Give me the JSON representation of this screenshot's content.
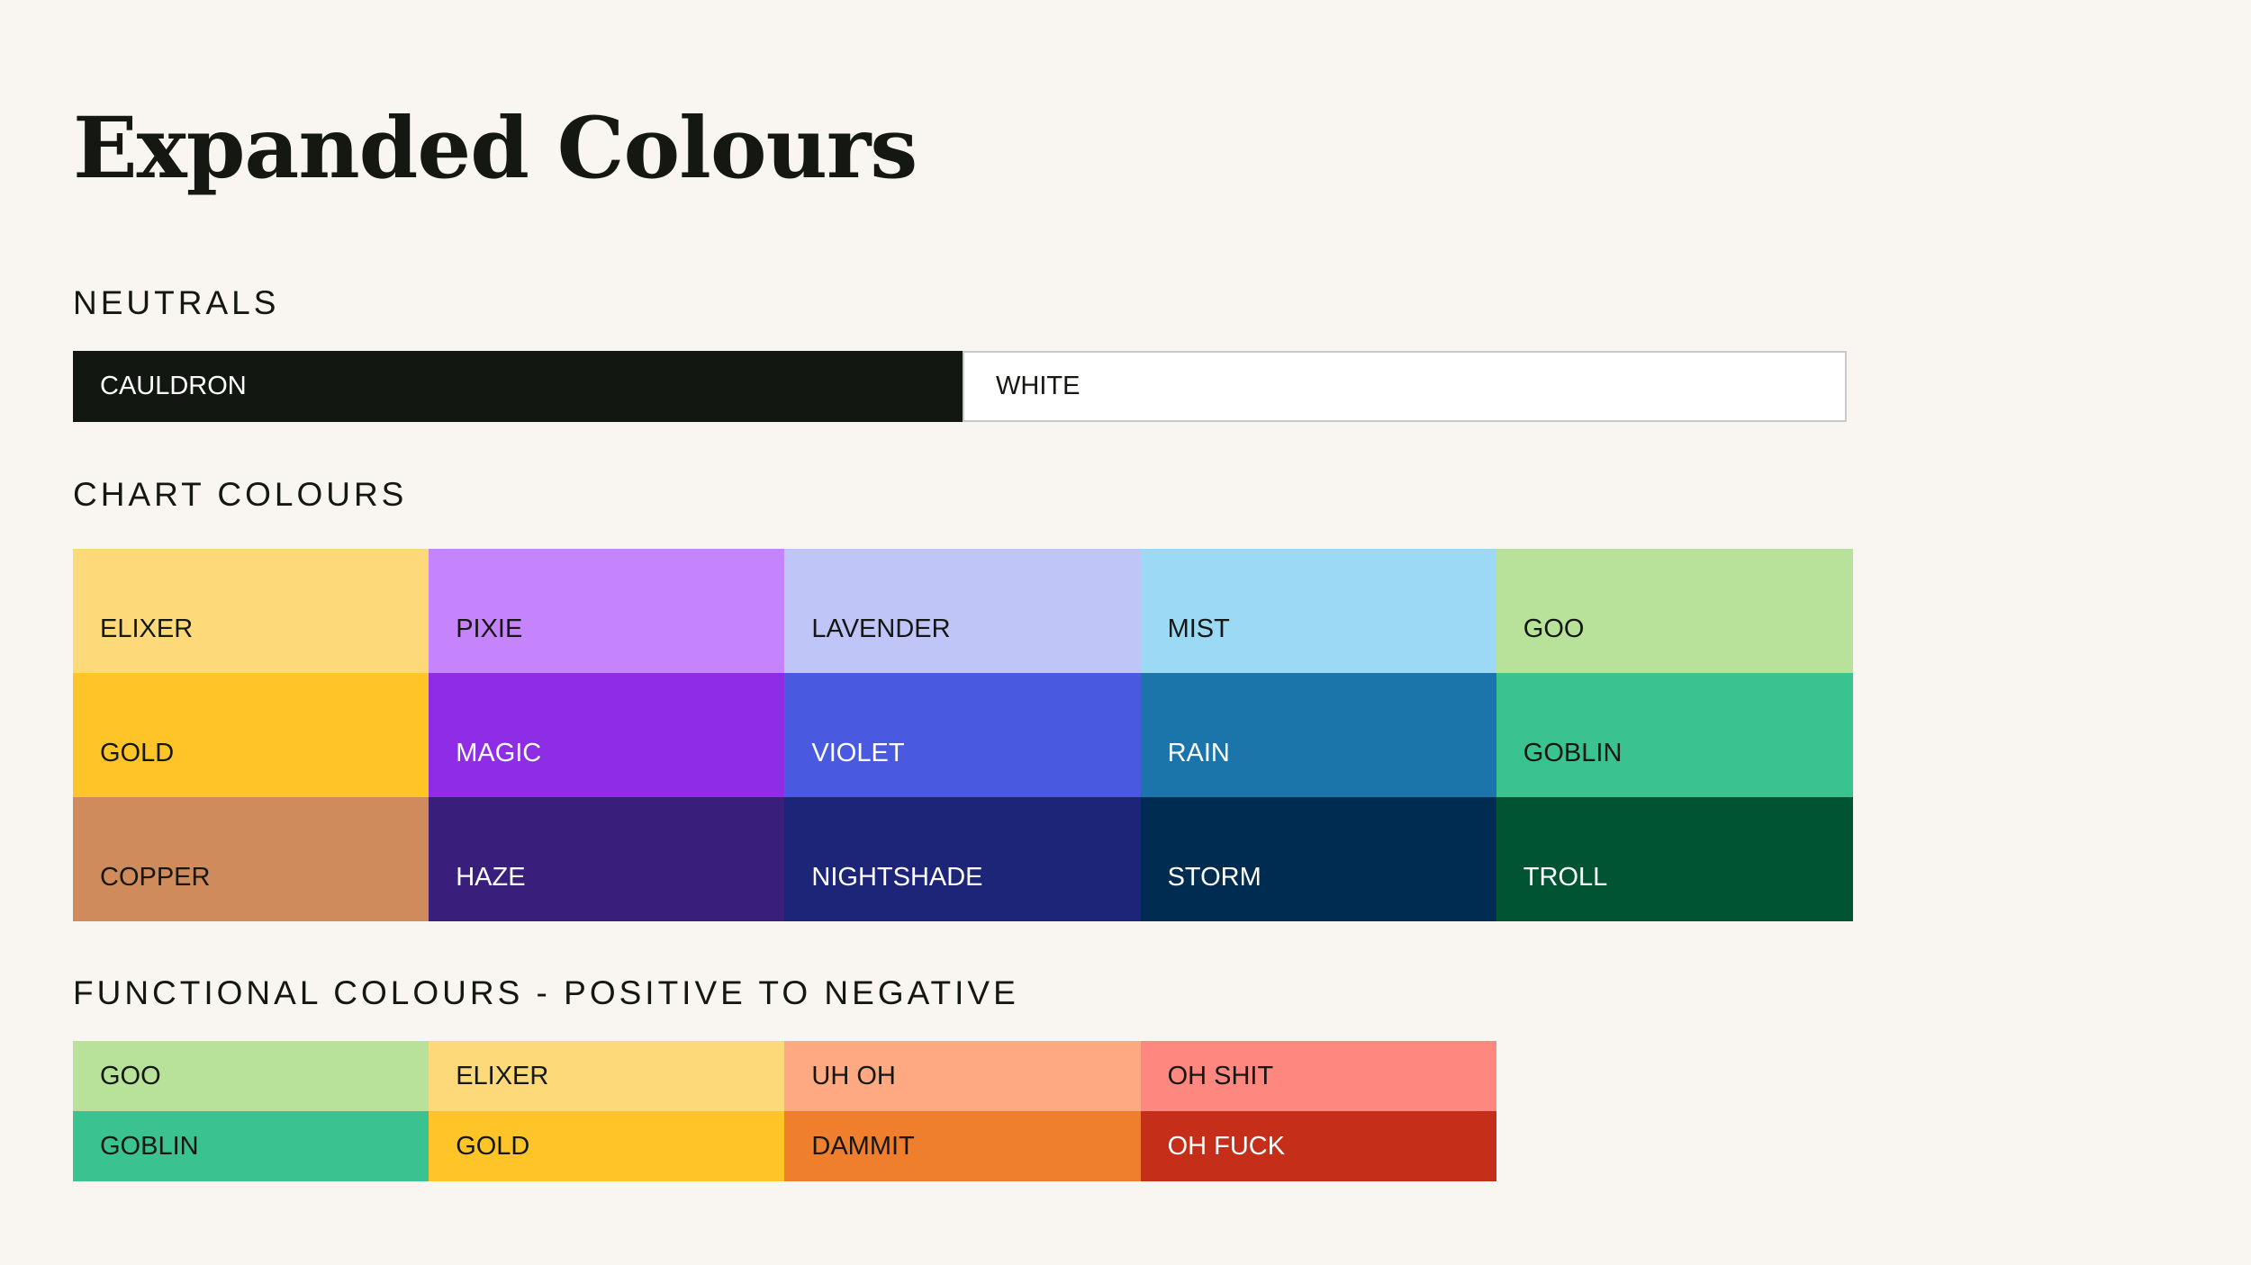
{
  "title": "Expanded Colours",
  "sections": {
    "neutrals": {
      "heading": "NEUTRALS",
      "swatches": [
        {
          "label": "CAULDRON",
          "color": "#131712",
          "text_color": "#ffffff"
        },
        {
          "label": "WHITE",
          "color": "#ffffff",
          "text_color": "#141712"
        }
      ]
    },
    "chart": {
      "heading": "CHART COLOURS",
      "rows": [
        [
          {
            "label": "ELIXER",
            "color": "#fed97a",
            "text_color": "#141712"
          },
          {
            "label": "PIXIE",
            "color": "#c684fc",
            "text_color": "#141712"
          },
          {
            "label": "LAVENDER",
            "color": "#c0c5f8",
            "text_color": "#141712"
          },
          {
            "label": "MIST",
            "color": "#9bd9f4",
            "text_color": "#141712"
          },
          {
            "label": "GOO",
            "color": "#b8e199",
            "text_color": "#141712"
          }
        ],
        [
          {
            "label": "GOLD",
            "color": "#fec428",
            "text_color": "#141712"
          },
          {
            "label": "MAGIC",
            "color": "#8e2ce6",
            "text_color": "#ffffff"
          },
          {
            "label": "VIOLET",
            "color": "#4a5ae0",
            "text_color": "#ffffff"
          },
          {
            "label": "RAIN",
            "color": "#1b74aa",
            "text_color": "#ffffff"
          },
          {
            "label": "GOBLIN",
            "color": "#3ac391",
            "text_color": "#141712"
          }
        ],
        [
          {
            "label": "COPPER",
            "color": "#cf8b5b",
            "text_color": "#141712"
          },
          {
            "label": "HAZE",
            "color": "#391f7b",
            "text_color": "#ffffff"
          },
          {
            "label": "NIGHTSHADE",
            "color": "#1d2579",
            "text_color": "#ffffff"
          },
          {
            "label": "STORM",
            "color": "#002c51",
            "text_color": "#ffffff"
          },
          {
            "label": "TROLL",
            "color": "#005433",
            "text_color": "#ffffff"
          }
        ]
      ]
    },
    "functional": {
      "heading": "FUNCTIONAL COLOURS - POSITIVE TO NEGATIVE",
      "rows": [
        [
          {
            "label": "GOO",
            "color": "#b8e199",
            "text_color": "#141712"
          },
          {
            "label": "ELIXER",
            "color": "#fed97a",
            "text_color": "#141712"
          },
          {
            "label": "UH OH",
            "color": "#fea981",
            "text_color": "#141712"
          },
          {
            "label": "OH SHIT",
            "color": "#fe8880",
            "text_color": "#141712"
          }
        ],
        [
          {
            "label": "GOBLIN",
            "color": "#3ac391",
            "text_color": "#141712"
          },
          {
            "label": "GOLD",
            "color": "#fec428",
            "text_color": "#141712"
          },
          {
            "label": "DAMMIT",
            "color": "#ef7f2c",
            "text_color": "#141712"
          },
          {
            "label": "OH FUCK",
            "color": "#c52f19",
            "text_color": "#ffffff"
          }
        ]
      ]
    }
  }
}
